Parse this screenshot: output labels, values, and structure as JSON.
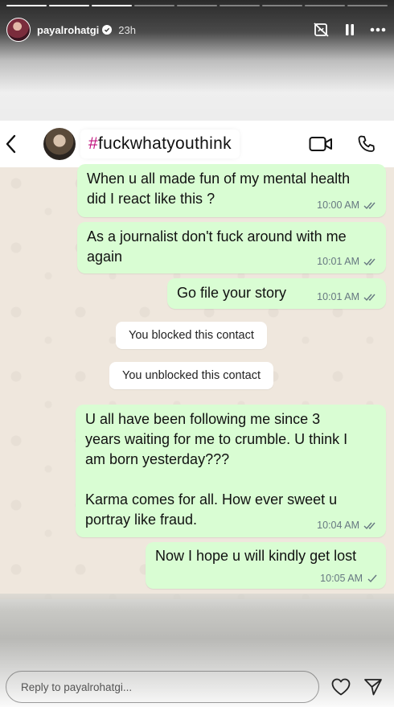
{
  "story": {
    "progress_segments": 9,
    "progress_done": 3,
    "username": "payalrohatgi",
    "time": "23h"
  },
  "wa": {
    "contact_hash": "#",
    "contact_name": "fuckwhatyouthink"
  },
  "messages": [
    {
      "text": "When u all made fun of my mental health\ndid I react like this ?",
      "time": "10:00 AM",
      "status": "read"
    },
    {
      "text": "As a journalist don't fuck around with me\nagain",
      "time": "10:01 AM",
      "status": "read"
    },
    {
      "text": "Go file your story",
      "time": "10:01 AM",
      "status": "read"
    },
    {
      "system": "You blocked this contact"
    },
    {
      "system": "You unblocked this contact"
    },
    {
      "text": "U all have been following me since 3\nyears waiting for me to crumble. U think I\nam born yesterday???\n\nKarma comes for all. How ever sweet u\nportray like fraud.",
      "time": "10:04 AM",
      "status": "read"
    },
    {
      "text": "Now I hope u will kindly get lost",
      "time": "10:05 AM",
      "status": "sent"
    }
  ],
  "reply": {
    "placeholder": "Reply to payalrohatgi..."
  },
  "colors": {
    "bubble": "#d9fdd3",
    "hashtag": "#c1117c",
    "chat_bg": "#efe7dd"
  },
  "icons": [
    "verified-icon",
    "mute-icon",
    "pause-icon",
    "more-icon",
    "back-arrow-icon",
    "video-call-icon",
    "phone-icon",
    "double-check-icon",
    "single-check-icon",
    "heart-icon",
    "send-icon"
  ]
}
